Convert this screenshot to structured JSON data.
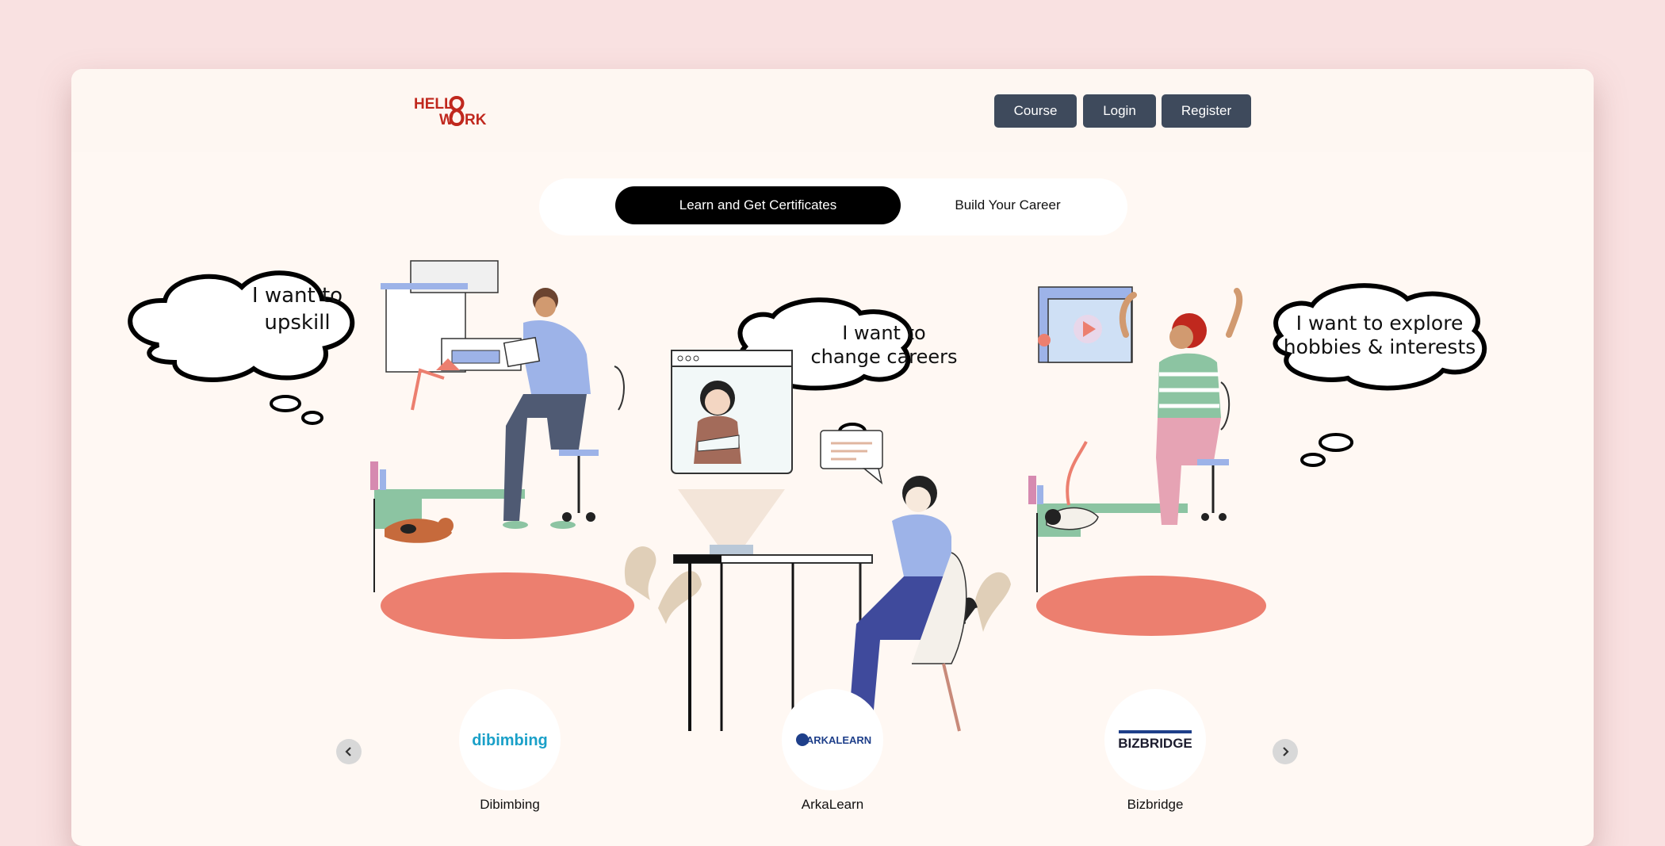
{
  "brand": {
    "logo_text": "HELLO WORK",
    "logo_line1": "HELL",
    "logo_line2": "W",
    "logo_line2_end": "RK",
    "accent": "#c0281e"
  },
  "nav": {
    "course_label": "Course",
    "login_label": "Login",
    "register_label": "Register"
  },
  "tabs": [
    {
      "label": "Learn and Get Certificates",
      "active": true
    },
    {
      "label": "Build Your Career",
      "active": false
    }
  ],
  "hero": {
    "bubbles": [
      {
        "line1": "I want to",
        "line2": "upskill"
      },
      {
        "line1": "I want to",
        "line2": "change careers"
      },
      {
        "line1": "I want to explore",
        "line2": "hobbies & interests"
      }
    ]
  },
  "partners": [
    {
      "name": "Dibimbing",
      "logo_text": "dibimbing",
      "color": "#1aa0c8"
    },
    {
      "name": "ArkaLearn",
      "logo_text": "ARKALEARN",
      "color": "#1e3f8a"
    },
    {
      "name": "Bizbridge",
      "logo_text": "BIZBRIDGE",
      "color": "#1c1c2e"
    }
  ],
  "carousel": {
    "prev_icon": "chevron-left-icon",
    "next_icon": "chevron-right-icon"
  },
  "colors": {
    "nav_button": "#3e4a5c",
    "page_bg": "#f9e1e1",
    "card_bg": "#fff8f3",
    "rug": "#ec7f6f"
  }
}
